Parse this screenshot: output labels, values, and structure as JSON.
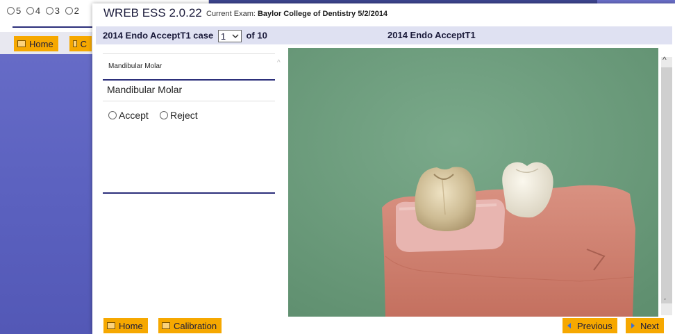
{
  "background_window": {
    "radio_options": [
      "5",
      "4",
      "3",
      "2"
    ],
    "home_label": "Home",
    "second_label": "C"
  },
  "app": {
    "title": "WREB ESS 2.0.22",
    "current_exam_label": "Current Exam:",
    "current_exam_value": "Baylor College of Dentistry 5/2/2014"
  },
  "case_bar": {
    "prefix": "2014 Endo AcceptT1 case",
    "selected_case": "1",
    "of_label": "of 10",
    "title": "2014 Endo AcceptT1"
  },
  "left_panel": {
    "tooth_small": "Mandibular Molar",
    "tooth_large": "Mandibular Molar",
    "options": [
      "Accept",
      "Reject"
    ]
  },
  "footer": {
    "home_label": "Home",
    "calibration_label": "Calibration",
    "previous_label": "Previous",
    "next_label": "Next"
  },
  "colors": {
    "accent_orange": "#f6a800",
    "navy": "#2b2e7a",
    "case_bar_bg": "#dfe1f2",
    "photo_background": "#6a9c7c",
    "gum_pink": "#d08372"
  },
  "icons": {
    "button_icon": "picture-icon",
    "previous_icon": "arrow-left-icon",
    "next_icon": "arrow-right-icon",
    "dropdown_icon": "chevron-down-icon"
  }
}
